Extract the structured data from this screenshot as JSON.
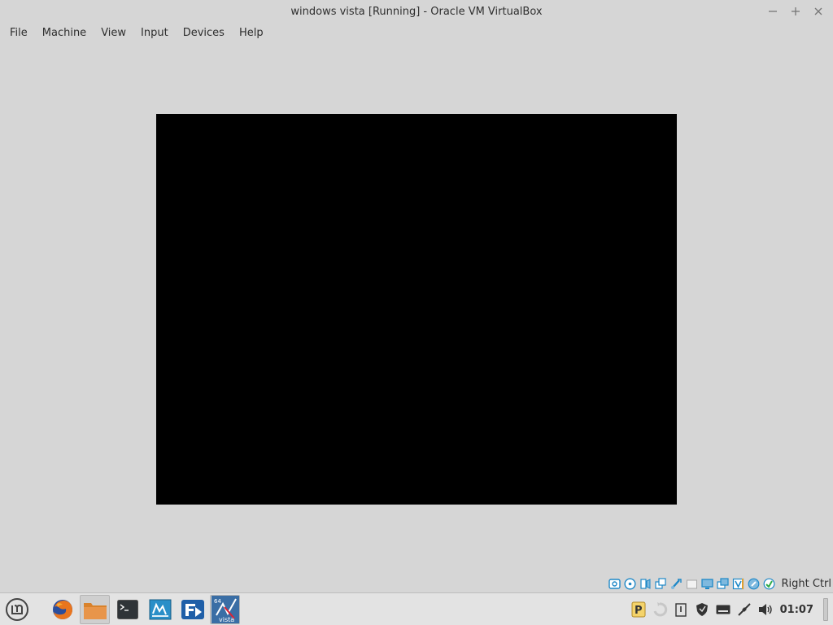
{
  "window": {
    "title": "windows vista [Running] - Oracle VM VirtualBox",
    "controls": [
      "minimize-icon",
      "maximize-icon",
      "close-icon"
    ]
  },
  "menubar": {
    "items": [
      "File",
      "Machine",
      "View",
      "Input",
      "Devices",
      "Help"
    ]
  },
  "vm_display": {
    "state": "black screen"
  },
  "status_bar": {
    "icons": [
      "hard-disk-icon",
      "optical-drive-icon",
      "audio-icon",
      "network-icon",
      "usb-icon",
      "shared-folders-icon",
      "display-icon",
      "video-capture-icon",
      "virtualization-icon",
      "mouse-integration-icon",
      "keyboard-capture-icon"
    ],
    "host_key": "Right Ctrl"
  },
  "panel": {
    "launchers": [
      {
        "name": "firefox-launcher",
        "icon": "firefox-icon"
      },
      {
        "name": "files-launcher",
        "icon": "folder-icon"
      },
      {
        "name": "terminal-launcher",
        "icon": "terminal-icon"
      },
      {
        "name": "virtualbox-manager-launcher",
        "icon": "virtualbox-icon"
      },
      {
        "name": "app-launcher",
        "icon": "app-icon"
      },
      {
        "name": "vista-vm-launcher",
        "icon": "vista-vm-icon",
        "badge_top": "64",
        "badge_bottom": "vista"
      }
    ],
    "tray": [
      "pamac-icon",
      "update-icon",
      "clipboard-icon",
      "shield-icon",
      "keyboard-icon",
      "network-icon",
      "volume-icon"
    ],
    "clock": "01:07"
  },
  "colors": {
    "window_bg": "#d6d6d6",
    "vm_screen": "#000000",
    "panel_bg": "#e3e3e3",
    "status_blue": "#1e88c7"
  }
}
